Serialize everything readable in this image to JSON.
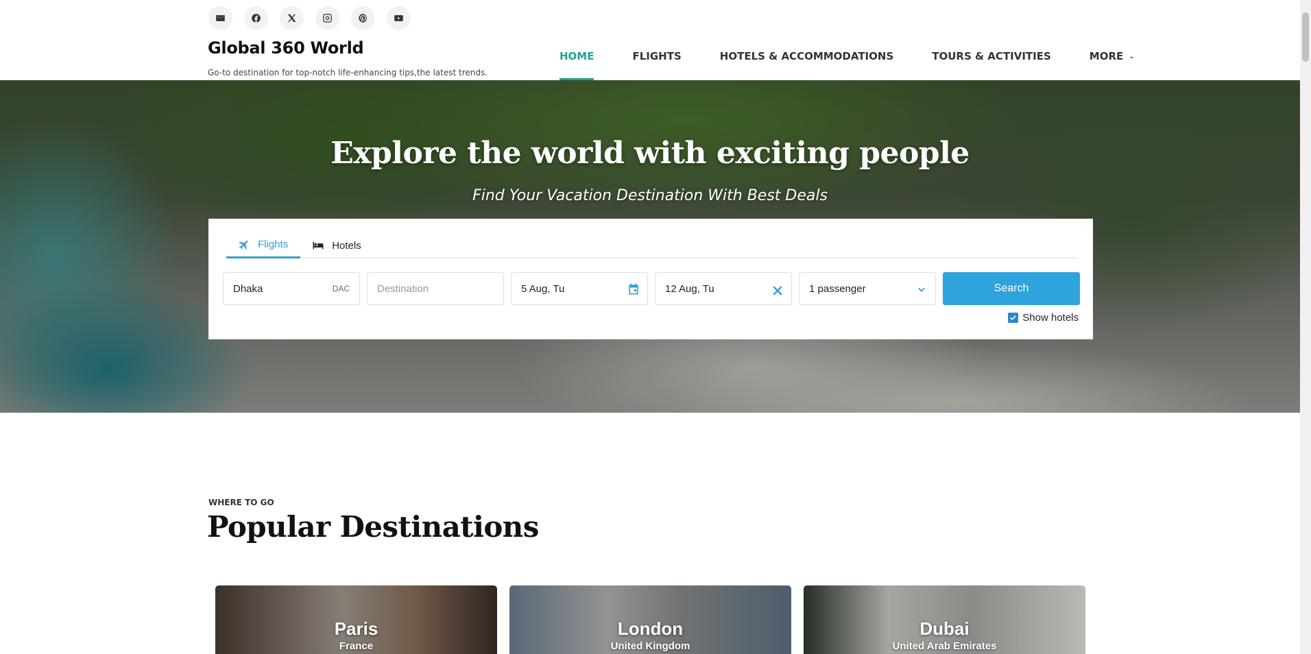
{
  "header": {
    "socials": [
      {
        "icon": "email-icon"
      },
      {
        "icon": "facebook-icon"
      },
      {
        "icon": "x-twitter-icon"
      },
      {
        "icon": "instagram-icon"
      },
      {
        "icon": "pinterest-icon"
      },
      {
        "icon": "youtube-icon"
      }
    ],
    "site_title": "Global 360 World",
    "tagline": "Go-to destination for top-notch life-enhancing tips,the latest trends.",
    "nav": [
      {
        "label": "HOME",
        "active": true
      },
      {
        "label": "FLIGHTS"
      },
      {
        "label": "HOTELS & ACCOMMODATIONS"
      },
      {
        "label": "TOURS & ACTIVITIES"
      },
      {
        "label": "MORE",
        "dropdown": true
      }
    ],
    "accent_color": "#20a38f"
  },
  "hero": {
    "title": "Explore the world with exciting people",
    "subtitle": "Find Your Vacation Destination With Best Deals"
  },
  "search": {
    "tabs": [
      {
        "label": "Flights",
        "icon": "plane-icon",
        "active": true
      },
      {
        "label": "Hotels",
        "icon": "bed-icon"
      }
    ],
    "origin": {
      "value": "Dhaka",
      "code": "DAC"
    },
    "destination": {
      "placeholder": "Destination"
    },
    "depart_date": "5 Aug, Tu",
    "return_date": "12 Aug, Tu",
    "passengers": "1 passenger",
    "search_label": "Search",
    "show_hotels_label": "Show hotels",
    "show_hotels_checked": true,
    "button_color": "#2ea3dc"
  },
  "destinations": {
    "kicker": "WHERE TO GO",
    "title": "Popular Destinations",
    "cards": [
      {
        "city": "Paris",
        "country": "France"
      },
      {
        "city": "London",
        "country": "United Kingdom"
      },
      {
        "city": "Dubai",
        "country": "United Arab Emirates"
      }
    ]
  }
}
